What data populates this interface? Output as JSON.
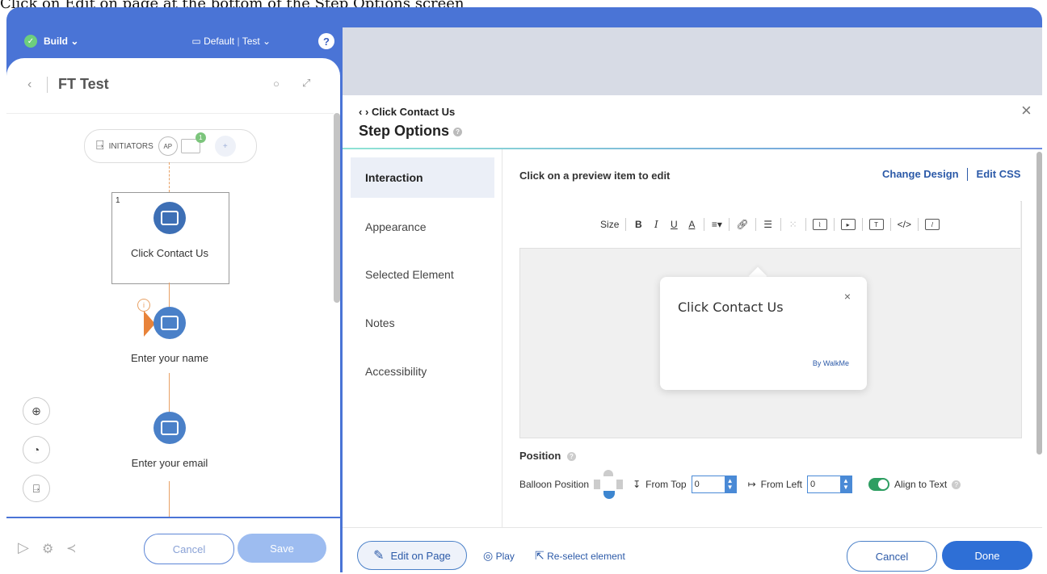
{
  "caption": "Click on Edit on page at the bottom of the Step Options screen",
  "left_header": {
    "mode_label": "Build",
    "env_label": "Default",
    "env_sep": "|",
    "env_test": "Test",
    "help": "?"
  },
  "flow": {
    "title": "FT Test",
    "initiators_label": "INITIATORS",
    "ap_badge": "AP",
    "count_badge": "1",
    "step_number": "1",
    "steps": [
      "Click Contact Us",
      "Enter your name",
      "Enter your email"
    ]
  },
  "left_footer": {
    "cancel": "Cancel",
    "save": "Save"
  },
  "modal": {
    "breadcrumb": "Click Contact Us",
    "title": "Step Options",
    "close": "×",
    "tabs": [
      "Interaction",
      "Appearance",
      "Selected Element",
      "Notes",
      "Accessibility"
    ],
    "active_tab": "Interaction",
    "hint": "Click on a preview item to edit",
    "change_design": "Change Design",
    "edit_css": "Edit CSS",
    "toolbar_size": "Size",
    "balloon": {
      "title": "Click Contact Us",
      "close": "×",
      "brand": "By WalkMe"
    },
    "position": {
      "label": "Position",
      "balloon_position": "Balloon Position",
      "from_top": "From Top",
      "from_top_value": "0",
      "from_left": "From Left",
      "from_left_value": "0",
      "align_to_text": "Align to Text",
      "align_to_text_on": true
    },
    "footer": {
      "edit_on_page": "Edit on Page",
      "play": "Play",
      "reselect": "Re-select element",
      "cancel": "Cancel",
      "done": "Done"
    }
  },
  "colors": {
    "brand_blue": "#4a74d6",
    "done_blue": "#2e6fd6",
    "toggle_green": "#2e9e62",
    "bubble_blue": "#4a80c8"
  }
}
